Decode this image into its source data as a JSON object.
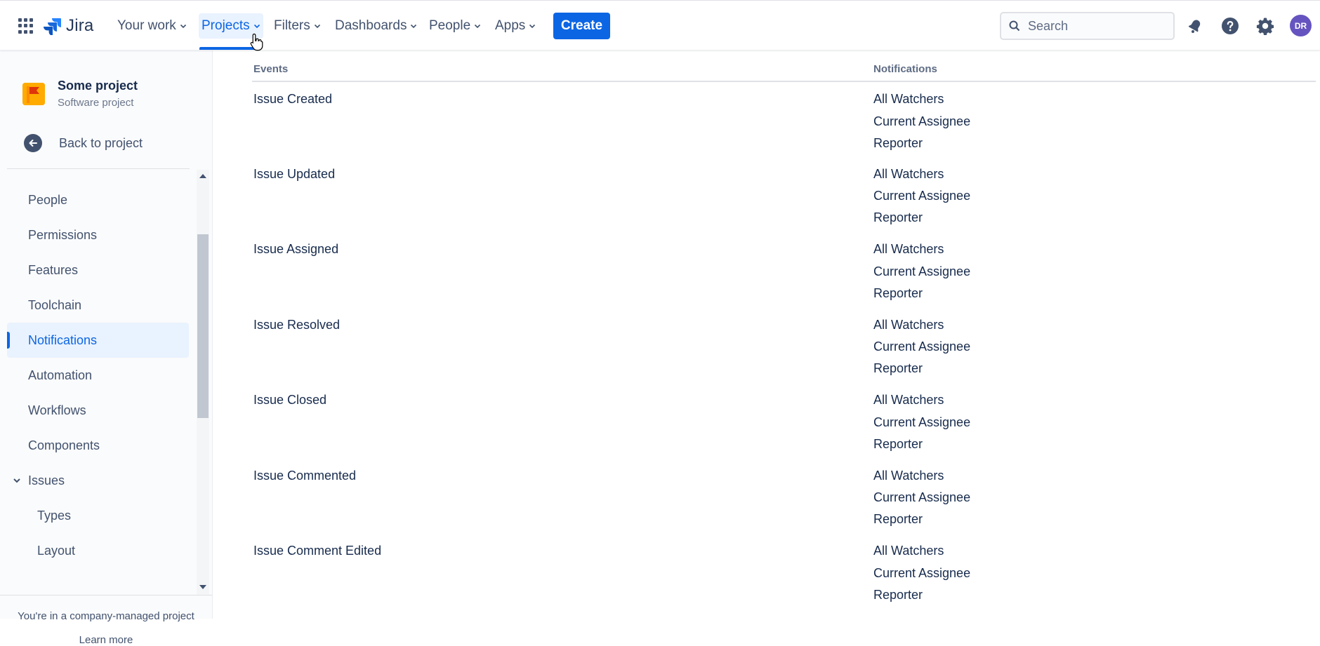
{
  "nav": {
    "logo_text": "Jira",
    "items": [
      {
        "label": "Your work"
      },
      {
        "label": "Projects"
      },
      {
        "label": "Filters"
      },
      {
        "label": "Dashboards"
      },
      {
        "label": "People"
      },
      {
        "label": "Apps"
      }
    ],
    "create_label": "Create",
    "search_placeholder": "Search",
    "avatar_initials": "DR",
    "accent_color": "#0c66e4"
  },
  "sidebar": {
    "project_name": "Some project",
    "project_type": "Software project",
    "back_label": "Back to project",
    "items": [
      {
        "label": "People"
      },
      {
        "label": "Permissions"
      },
      {
        "label": "Features"
      },
      {
        "label": "Toolchain"
      },
      {
        "label": "Notifications"
      },
      {
        "label": "Automation"
      },
      {
        "label": "Workflows"
      },
      {
        "label": "Components"
      },
      {
        "label": "Issues"
      },
      {
        "label": "Types"
      },
      {
        "label": "Layout"
      }
    ],
    "footer_text": "You're in a company-managed project",
    "footer_link": "Learn more"
  },
  "table": {
    "headers": [
      "Events",
      "Notifications"
    ],
    "rows": [
      {
        "event": "Issue Created",
        "notifications": [
          "All Watchers",
          "Current Assignee",
          "Reporter"
        ]
      },
      {
        "event": "Issue Updated",
        "notifications": [
          "All Watchers",
          "Current Assignee",
          "Reporter"
        ]
      },
      {
        "event": "Issue Assigned",
        "notifications": [
          "All Watchers",
          "Current Assignee",
          "Reporter"
        ]
      },
      {
        "event": "Issue Resolved",
        "notifications": [
          "All Watchers",
          "Current Assignee",
          "Reporter"
        ]
      },
      {
        "event": "Issue Closed",
        "notifications": [
          "All Watchers",
          "Current Assignee",
          "Reporter"
        ]
      },
      {
        "event": "Issue Commented",
        "notifications": [
          "All Watchers",
          "Current Assignee",
          "Reporter"
        ]
      },
      {
        "event": "Issue Comment Edited",
        "notifications": [
          "All Watchers",
          "Current Assignee",
          "Reporter"
        ]
      }
    ]
  }
}
